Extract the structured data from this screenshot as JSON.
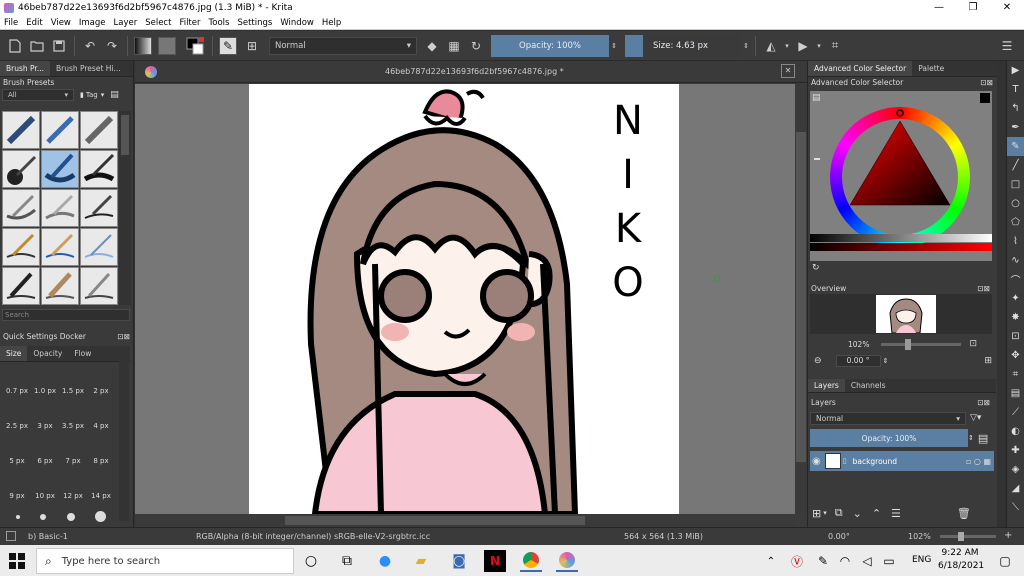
{
  "window": {
    "title": "46beb787d22e13693f6d2bf5967c4876.jpg (1.3 MiB)  * - Krita",
    "minimize": "—",
    "restore": "❐",
    "close": "✕"
  },
  "menu": [
    "File",
    "Edit",
    "View",
    "Image",
    "Layer",
    "Select",
    "Filter",
    "Tools",
    "Settings",
    "Window",
    "Help"
  ],
  "toolbar": {
    "blend_mode": "Normal",
    "opacity": "Opacity: 100%",
    "size": "Size: 4.63 px"
  },
  "left_panel": {
    "tabs": [
      "Brush Pr...",
      "Brush Preset Hi..."
    ],
    "brush_presets_title": "Brush Presets",
    "filter_all": "All",
    "tag_label": "Tag",
    "search_placeholder": "Search",
    "quick_settings_title": "Quick Settings Docker",
    "quick_tabs": [
      "Size",
      "Opacity",
      "Flow"
    ],
    "sizes": [
      "0.7 px",
      "1.0 px",
      "1.5 px",
      "2 px",
      "2.5 px",
      "3 px",
      "3.5 px",
      "4 px",
      "5 px",
      "6 px",
      "7 px",
      "8 px",
      "9 px",
      "10 px",
      "12 px",
      "14 px"
    ]
  },
  "document": {
    "tab_title": "46beb787d22e13693f6d2bf5967c4876.jpg *",
    "close": "✕",
    "canvas_text": [
      "N",
      "I",
      "K",
      "O"
    ]
  },
  "right_panel": {
    "tabs": [
      "Advanced Color Selector",
      "Palette"
    ],
    "color_selector_title": "Advanced Color Selector",
    "overview_title": "Overview",
    "zoom": "102%",
    "rotation": "0.00 °",
    "layer_tabs": [
      "Layers",
      "Channels"
    ],
    "layers_title": "Layers",
    "layer_blend": "Normal",
    "layer_opacity": "Opacity:  100%",
    "layer_name": "background"
  },
  "status": {
    "brush": "b) Basic-1",
    "color_model": "RGB/Alpha (8-bit integer/channel)  sRGB-elle-V2-srgbtrc.icc",
    "image_size": "564 x 564 (1.3 MiB)",
    "rotation": "0.00°",
    "zoom": "102%"
  },
  "taskbar": {
    "search_placeholder": "Type here to search",
    "language": "ENG",
    "time": "9:22 AM",
    "date": "6/18/2021"
  },
  "colors": {
    "accent": "#5a7fa3",
    "hair": "#a48a80",
    "skin": "#fdf1ec",
    "shirt": "#f7c7d4",
    "blush": "#f2b3b3"
  }
}
